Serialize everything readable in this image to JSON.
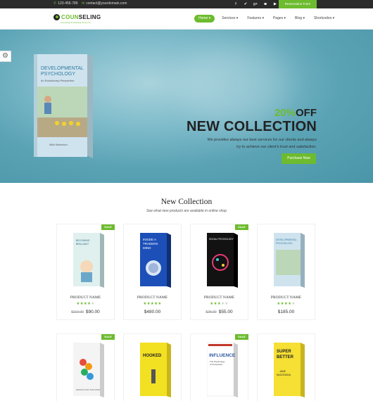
{
  "topbar": {
    "phone": "123-456-789",
    "email": "contact@yourdomain.com",
    "social_icons": [
      "facebook-icon",
      "twitter-icon",
      "google-plus-icon",
      "instagram-icon",
      "youtube-icon"
    ],
    "reserve_label": "Reservation Form"
  },
  "logo": {
    "name_prefix": "COUN",
    "name_suffix": "SELING",
    "tagline": "Counseling & Coaching Theme for..."
  },
  "nav": [
    {
      "label": "Home ▾",
      "active": true
    },
    {
      "label": "Services ▾"
    },
    {
      "label": "Features ▾"
    },
    {
      "label": "Pages ▾"
    },
    {
      "label": "Blog ▾"
    },
    {
      "label": "Shortcodes ▾"
    }
  ],
  "hero": {
    "book_title": "DEVELOPMENTAL PSYCHOLOGY",
    "book_subtitle": "An Evolutionary Perspective",
    "book_author": "Wills Rutherford",
    "discount": "20%",
    "discount_suffix": "OFF",
    "title": "NEW COLLECTION",
    "description_line1": "We provides always our best services for our clients and always",
    "description_line2": "try to achieve our client's trust and satisfaction.",
    "cta": "Purchase Now"
  },
  "section": {
    "title": "New Collection",
    "subtitle": "See what new products are available in online shop"
  },
  "products": [
    {
      "name": "PRODUCT NAME",
      "sale": "SALE",
      "rating": 4,
      "old_price": "$110.00",
      "price": "$90.00",
      "cover_color": "#dff0ee",
      "cover_text": "BECOMING BRILLIANT"
    },
    {
      "name": "PRODUCT NAME",
      "sale": "",
      "rating": 5,
      "old_price": "",
      "price": "$480.00",
      "cover_color": "#1c4fb8",
      "cover_text": "INSIDE A TRADERS MIND"
    },
    {
      "name": "PRODUCT NAME",
      "sale": "SALE",
      "rating": 3,
      "old_price": "$25.00",
      "price": "$55.00",
      "cover_color": "#121212",
      "cover_text": "SOCIAL PSYCHOLOGY"
    },
    {
      "name": "PRODUCT NAME",
      "sale": "",
      "rating": 4,
      "old_price": "",
      "price": "$185.00",
      "cover_color": "#cfe3ee",
      "cover_text": "DEVELOPMENTAL PSYCHOLOGY"
    },
    {
      "sale": "SALE",
      "cover_color": "#f4f4f4",
      "cover_text": "DESIGN FOR THE MIND"
    },
    {
      "sale": "",
      "cover_color": "#f2e023",
      "cover_text": "HOOKED"
    },
    {
      "sale": "SALE",
      "cover_color": "#ffffff",
      "cover_text": "INFLUENCE"
    },
    {
      "sale": "",
      "cover_color": "#f5e033",
      "cover_text": "SUPER BETTER"
    }
  ]
}
